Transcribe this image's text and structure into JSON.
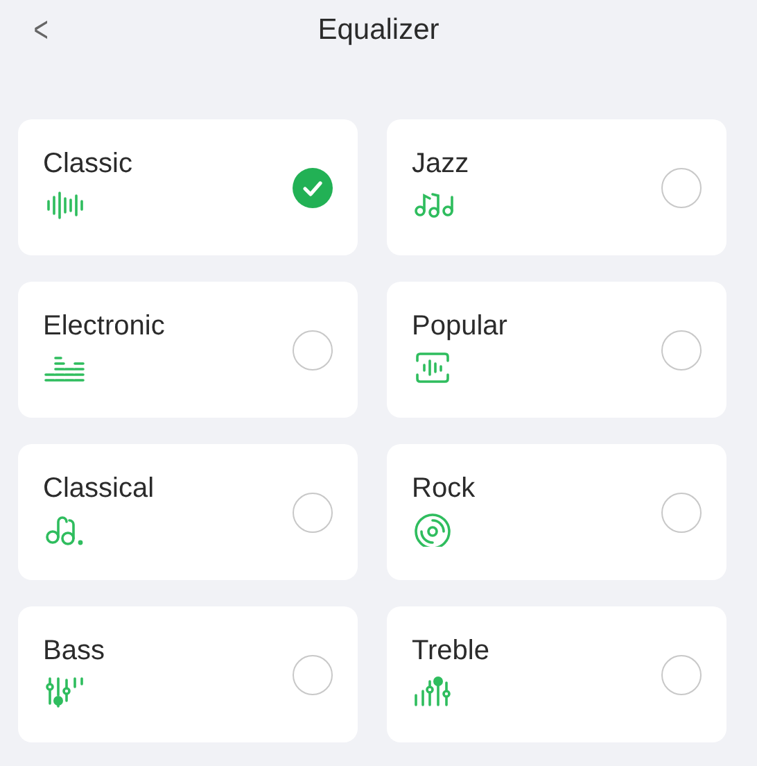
{
  "header": {
    "back": "<",
    "title": "Equalizer"
  },
  "presets": [
    {
      "label": "Classic",
      "kind": "wave",
      "selected": true
    },
    {
      "label": "Jazz",
      "kind": "notes",
      "selected": false
    },
    {
      "label": "Electronic",
      "kind": "equalizer",
      "selected": false
    },
    {
      "label": "Popular",
      "kind": "framed",
      "selected": false
    },
    {
      "label": "Classical",
      "kind": "dotted",
      "selected": false
    },
    {
      "label": "Rock",
      "kind": "disc",
      "selected": false
    },
    {
      "label": "Bass",
      "kind": "low",
      "selected": false
    },
    {
      "label": "Treble",
      "kind": "high",
      "selected": false
    }
  ]
}
